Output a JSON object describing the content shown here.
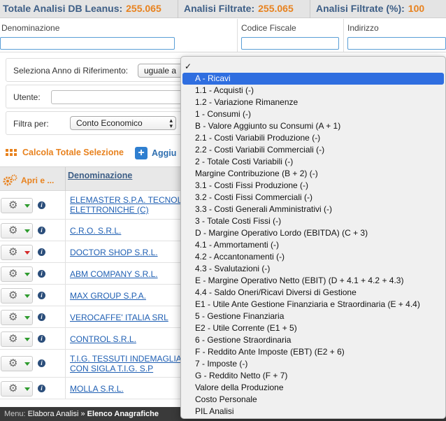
{
  "stats": [
    {
      "label": "Totale Analisi DB Leanus:",
      "value": "255.065"
    },
    {
      "label": "Analisi Filtrate:",
      "value": "255.065"
    },
    {
      "label": "Analisi Filtrate (%):",
      "value": "100"
    }
  ],
  "columns": {
    "denominazione": "Denominazione",
    "codice_fiscale": "Codice Fiscale",
    "indirizzo": "Indirizzo"
  },
  "filters": {
    "anno_label": "Seleziona Anno di Riferimento:",
    "anno_value": "uguale a",
    "utente_label": "Utente:",
    "filtra_label": "Filtra per:",
    "filtra_value": "Conto Economico"
  },
  "actions": {
    "calcola": "Calcola Totale Selezione",
    "aggiungi": "Aggiu"
  },
  "table": {
    "col1": "Apri e ...",
    "col2": "Denominazione",
    "rows": [
      {
        "name_line1": "ELEMASTER S.P.A. TECNOLOG",
        "name_line2": "ELETTRONICHE (C)",
        "flag": "green"
      },
      {
        "name_line1": "C.R.O. S.R.L.",
        "name_line2": "",
        "flag": "green"
      },
      {
        "name_line1": "DOCTOR SHOP S.R.L.",
        "name_line2": "",
        "flag": "red"
      },
      {
        "name_line1": "ABM COMPANY S.R.L.",
        "name_line2": "",
        "flag": "green"
      },
      {
        "name_line1": "MAX GROUP S.P.A.",
        "name_line2": "",
        "flag": "green"
      },
      {
        "name_line1": "VEROCAFFE' ITALIA SRL",
        "name_line2": "",
        "flag": "green"
      },
      {
        "name_line1": "CONTROL S.R.L.",
        "name_line2": "",
        "flag": "green"
      },
      {
        "name_line1": "T.I.G. TESSUTI INDEMAGLIAB",
        "name_line2": "CON SIGLA T.I.G. S.P",
        "flag": "green"
      },
      {
        "name_line1": "MOLLA S.R.L.",
        "name_line2": "",
        "flag": "green"
      }
    ]
  },
  "menu": {
    "prefix": "Menu:",
    "path": "Elabora Analisi",
    "sep": "»",
    "current": "Elenco Anagrafiche"
  },
  "dropdown": {
    "checkmark": "✓",
    "selected_index": 0,
    "options": [
      "A - Ricavi",
      "1.1 - Acquisti (-)",
      "1.2 - Variazione Rimanenze",
      "1 - Consumi (-)",
      "B - Valore Aggiunto su Consumi (A + 1)",
      "2.1 - Costi Variabili Produzione (-)",
      "2.2 - Costi Variabili Commerciali (-)",
      "2 - Totale Costi Variabili (-)",
      "Margine Contribuzione (B + 2) (-)",
      "3.1 - Costi Fissi Produzione (-)",
      "3.2 - Costi Fissi Commerciali (-)",
      "3.3 - Costi Generali Amministrativi (-)",
      "3 - Totale Costi Fissi (-)",
      "D - Margine Operativo Lordo (EBITDA) (C + 3)",
      "4.1 - Ammortamenti (-)",
      "4.2 - Accantonamenti (-)",
      "4.3 - Svalutazioni (-)",
      "E - Margine Operativo Netto (EBIT) (D + 4.1 + 4.2 + 4.3)",
      "4.4 - Saldo Oneri/Ricavi Diversi di Gestione",
      "E1 - Utile Ante Gestione Finanziaria e Straordinaria (E + 4.4)",
      "5 - Gestione Finanziaria",
      "E2 - Utile Corrente (E1 + 5)",
      "6 - Gestione Straordinaria",
      "F - Reddito Ante Imposte (EBT) (E2 + 6)",
      "7 - Imposte (-)",
      "G - Reddito Netto (F + 7)",
      "Valore della Produzione",
      "Costo Personale",
      "PIL Analisi"
    ]
  }
}
